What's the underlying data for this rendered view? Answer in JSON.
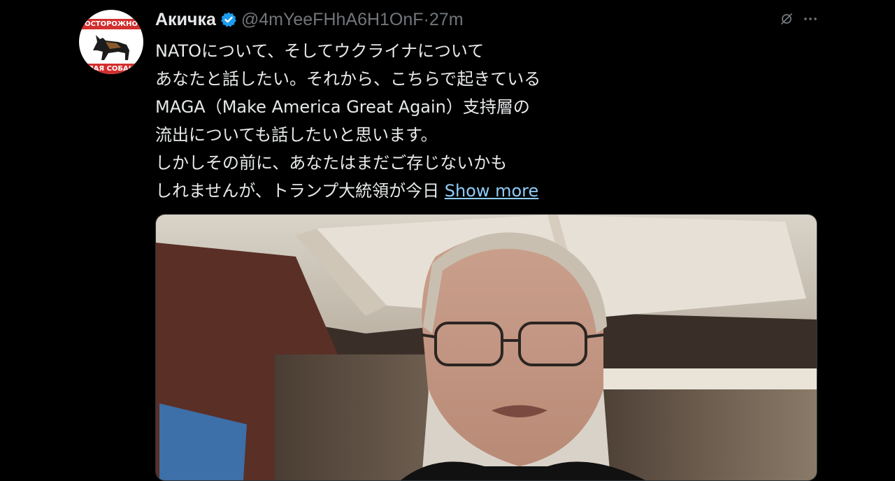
{
  "tweet": {
    "display_name": "Акичка",
    "handle": "@4mYeeFHhA6H1OnF",
    "separator": "·",
    "time": "27m",
    "avatar": {
      "top_text": "ОСТОРОЖНО",
      "bottom_text": "ЗЛАЯ СОБАКА"
    },
    "lines": [
      "NATOについて、そしてウクライナについて",
      "あなたと話したい。それから、こちらで起きている",
      "MAGA（Make America Great Again）支持層の",
      "流出についても話したいと思います。",
      "しかしその前に、あなたはまだご存じないかも",
      "しれませんが、トランプ大統領が今日"
    ],
    "show_more": "Show more",
    "icons": [
      "grok-icon",
      "more-options-icon",
      "verified-badge-icon"
    ],
    "colors": {
      "background": "#000000",
      "text": "#e7e9ea",
      "secondary": "#71767b",
      "link": "#8ecdf8",
      "verified": "#1d9bf0"
    }
  }
}
